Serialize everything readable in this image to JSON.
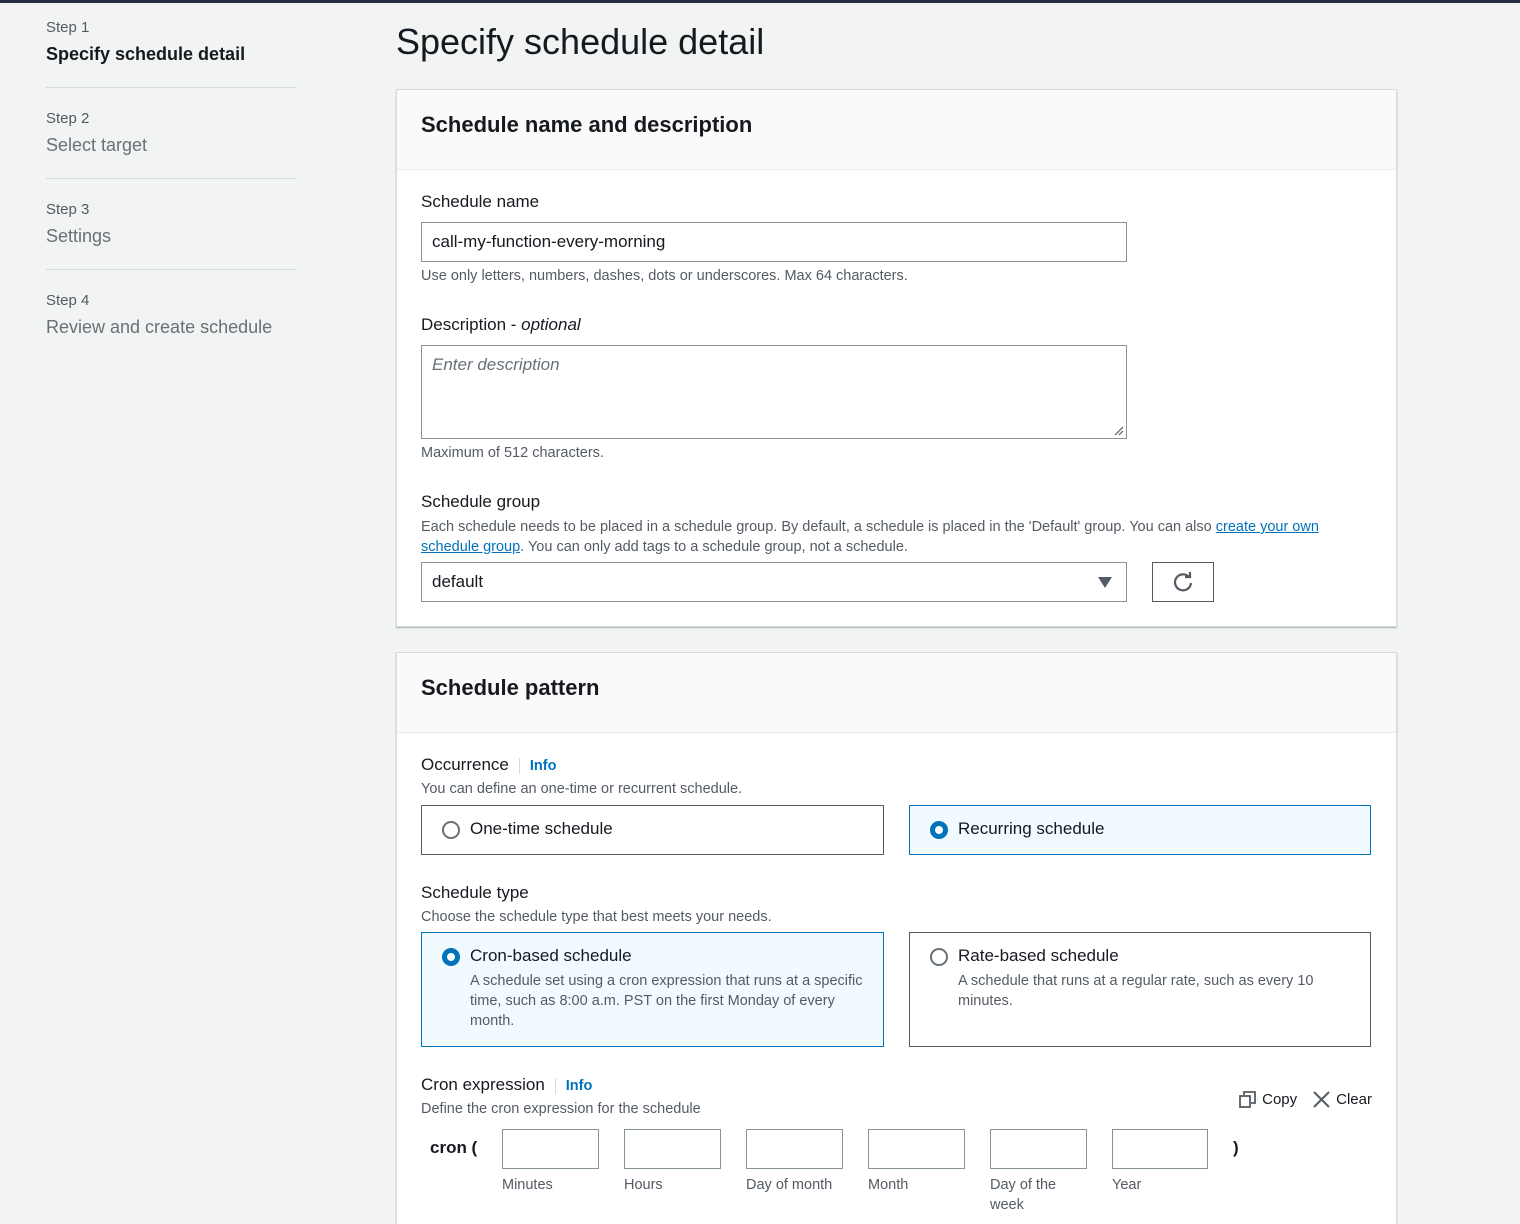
{
  "steps": [
    {
      "num": "Step 1",
      "title": "Specify schedule detail"
    },
    {
      "num": "Step 2",
      "title": "Select target"
    },
    {
      "num": "Step 3",
      "title": "Settings"
    },
    {
      "num": "Step 4",
      "title": "Review and create schedule"
    }
  ],
  "page_title": "Specify schedule detail",
  "name_panel": {
    "title": "Schedule name and description",
    "name_label": "Schedule name",
    "name_value": "call-my-function-every-morning",
    "name_hint": "Use only letters, numbers, dashes, dots or underscores. Max 64 characters.",
    "desc_label": "Description - ",
    "desc_optional": "optional",
    "desc_placeholder": "Enter description",
    "desc_hint": "Maximum of 512 characters.",
    "group_label": "Schedule group",
    "group_hint_pre": "Each schedule needs to be placed in a schedule group. By default, a schedule is placed in the 'Default' group. You can also ",
    "group_hint_link": "create your own schedule group",
    "group_hint_post": ". You can only add tags to a schedule group, not a schedule.",
    "group_value": "default"
  },
  "pattern_panel": {
    "title": "Schedule pattern",
    "occurrence_label": "Occurrence",
    "info": "Info",
    "occurrence_hint": "You can define an one-time or recurrent schedule.",
    "one_time": "One-time schedule",
    "recurring": "Recurring schedule",
    "type_label": "Schedule type",
    "type_hint": "Choose the schedule type that best meets your needs.",
    "cron_title": "Cron-based schedule",
    "cron_desc": "A schedule set using a cron expression that runs at a specific time, such as 8:00 a.m. PST on the first Monday of every month.",
    "rate_title": "Rate-based schedule",
    "rate_desc": "A schedule that runs at a regular rate, such as every 10 minutes.",
    "cron_expr_label": "Cron expression",
    "cron_expr_hint": "Define the cron expression for the schedule",
    "copy": "Copy",
    "clear": "Clear",
    "cron_prefix": "cron (",
    "cron_suffix": ")",
    "fields": [
      "Minutes",
      "Hours",
      "Day of month",
      "Month",
      "Day of the week",
      "Year"
    ]
  }
}
